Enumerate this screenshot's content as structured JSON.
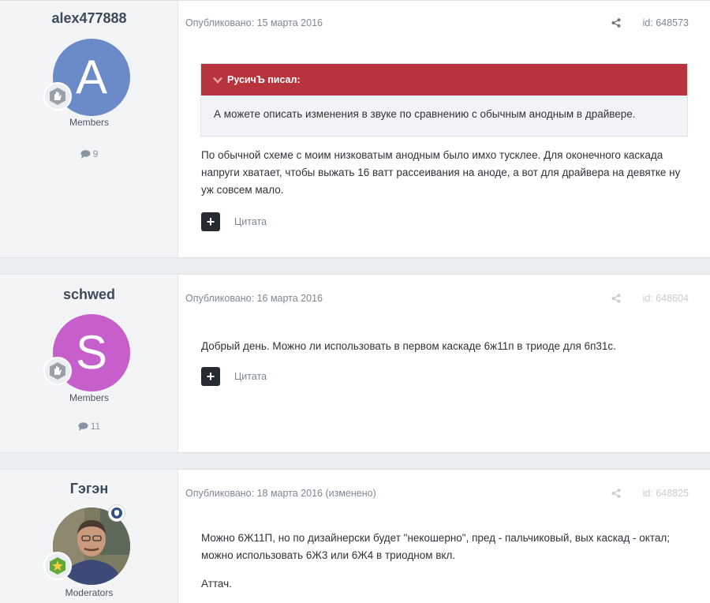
{
  "posts": [
    {
      "author": "alex477888",
      "avatar_letter": "A",
      "group": "Members",
      "post_count": "9",
      "published": "Опубликовано: 15 марта 2016",
      "id": "id: 648573",
      "quote": {
        "header": "РусичЪ писал:",
        "body": "А можете описать изменения в звуке по сравнению с обычным анодным в драйвере."
      },
      "text": "По обычной схеме с моим низковатым анодным было имхо тусклее. Для оконечного каскада напруги хватает, чтобы выжать 16 ватт рассеивания на аноде, а вот для драйвера на девятке ну уж совсем мало.",
      "quote_label": "Цитата"
    },
    {
      "author": "schwed",
      "avatar_letter": "S",
      "group": "Members",
      "post_count": "11",
      "published": "Опубликовано: 16 марта 2016",
      "id": "id: 648604",
      "text": "Добрый день. Можно ли использовать в первом каскаде 6ж11п в триоде для 6п31с.",
      "quote_label": "Цитата"
    },
    {
      "author": "Гэгэн",
      "group": "Moderators",
      "published": "Опубликовано: 18 марта 2016 (изменено)",
      "id": "id: 648825",
      "text": "Можно 6Ж11П, но по дизайнерски будет \"некошерно\", пред - пальчиковый, вых каскад - октал; можно использовать 6Ж3 или 6Ж4 в триодном вкл.",
      "text2": "Аттач."
    }
  ],
  "colors": {
    "quote_header": "#b8343c",
    "avatar_a": "#6b8ac8",
    "avatar_s": "#c65fcb"
  },
  "icons": {
    "share": "share-icon",
    "comment": "comment-icon",
    "rank": "hand-rank-icon",
    "moderator": "shield-icon",
    "star": "star-rank-icon"
  }
}
